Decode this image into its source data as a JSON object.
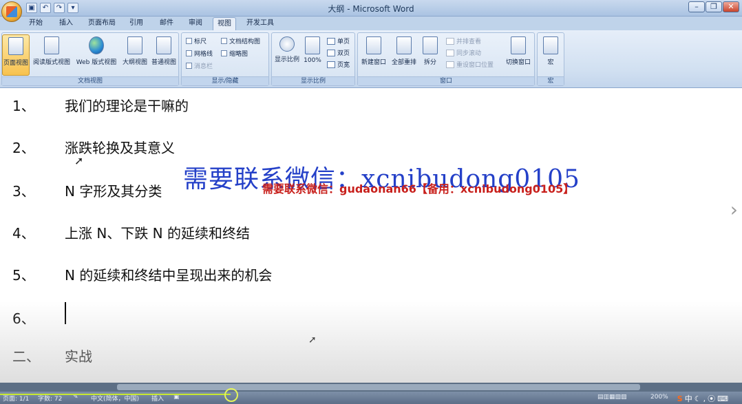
{
  "window": {
    "title": "大纲 - Microsoft Word",
    "ctrl_min": "–",
    "ctrl_restore": "❐",
    "ctrl_close": "✕"
  },
  "qat": {
    "save": "▣",
    "undo": "↶",
    "redo": "↷",
    "more": "▾"
  },
  "tabs": [
    "开始",
    "插入",
    "页面布局",
    "引用",
    "邮件",
    "审阅",
    "视图",
    "开发工具"
  ],
  "active_tab": "视图",
  "ribbon": {
    "doc_views": {
      "label": "文档视图",
      "buttons": [
        "页面视图",
        "阅读版式视图",
        "Web 版式视图",
        "大纲视图",
        "普通视图"
      ]
    },
    "show_hide": {
      "label": "显示/隐藏",
      "ruler": "标尺",
      "gridlines": "网格线",
      "message_bar": "消息栏",
      "doc_map": "文档结构图",
      "thumbnails": "缩略图"
    },
    "zoom": {
      "label": "显示比例",
      "zoom": "显示比例",
      "hundred": "100%",
      "one_page": "单页",
      "two_pages": "双页",
      "page_width": "页宽"
    },
    "window": {
      "label": "窗口",
      "new_window": "新建窗口",
      "arrange_all": "全部重排",
      "split": "拆分",
      "side_by_side": "并排查看",
      "sync_scroll": "同步滚动",
      "reset_pos": "重设窗口位置",
      "switch": "切换窗口"
    },
    "macros": {
      "label": "宏",
      "macros": "宏"
    }
  },
  "document": {
    "lines": [
      {
        "num": "1、",
        "text": "我们的理论是干嘛的"
      },
      {
        "num": "2、",
        "text": "涨跌轮换及其意义"
      },
      {
        "num": "3、",
        "text": "N 字形及其分类"
      },
      {
        "num": "4、",
        "text": "上涨 N、下跌 N 的延续和终结"
      },
      {
        "num": "5、",
        "text": "N 的延续和终结中呈现出来的机会"
      },
      {
        "num": "6、",
        "text": ""
      },
      {
        "num": "二、",
        "text": "实战"
      }
    ],
    "watermark_blue": "需要联系微信：xcnibudong0105",
    "watermark_red": "需要联系微信：gudaonan66【备用：xcnibudong0105】"
  },
  "status": {
    "page": "页面: 1/1",
    "words": "字数: 72",
    "language": "中文(简体，中国)",
    "insert": "插入",
    "zoom": "200%",
    "ime": "中"
  }
}
